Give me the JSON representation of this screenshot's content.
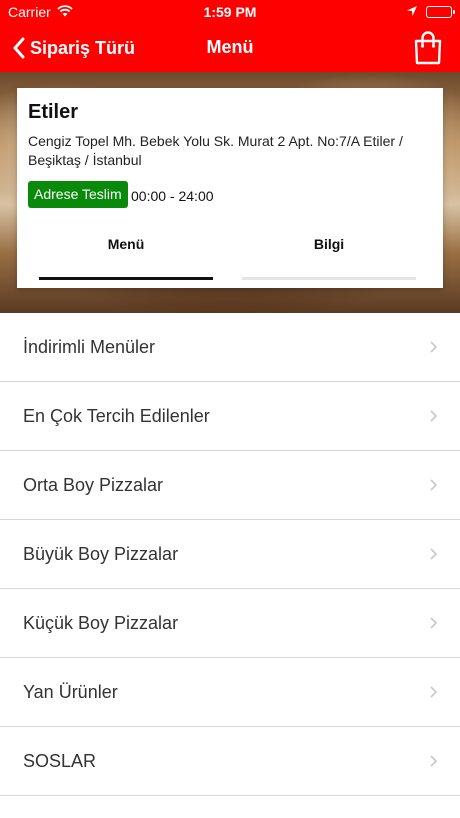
{
  "status_bar": {
    "carrier": "Carrier",
    "time": "1:59 PM"
  },
  "nav": {
    "back_label": "Sipariş Türü",
    "title": "Menü",
    "cart_icon": "shopping-bag-icon"
  },
  "store": {
    "name": "Etiler",
    "address": "Cengiz Topel Mh. Bebek Yolu Sk. Murat 2 Apt. No:7/A Etiler / Beşiktaş / İstanbul",
    "delivery_badge": "Adrese Teslim",
    "hours": "00:00 - 24:00"
  },
  "tabs": [
    {
      "label": "Menü",
      "active": true
    },
    {
      "label": "Bilgi",
      "active": false
    }
  ],
  "menu_categories": [
    "İndirimli Menüler",
    "En Çok Tercih Edilenler",
    "Orta Boy Pizzalar",
    "Büyük Boy Pizzalar",
    "Küçük Boy Pizzalar",
    "Yan Ürünler",
    "SOSLAR"
  ],
  "colors": {
    "primary": "#fe0000",
    "badge": "#0a8a0a"
  }
}
